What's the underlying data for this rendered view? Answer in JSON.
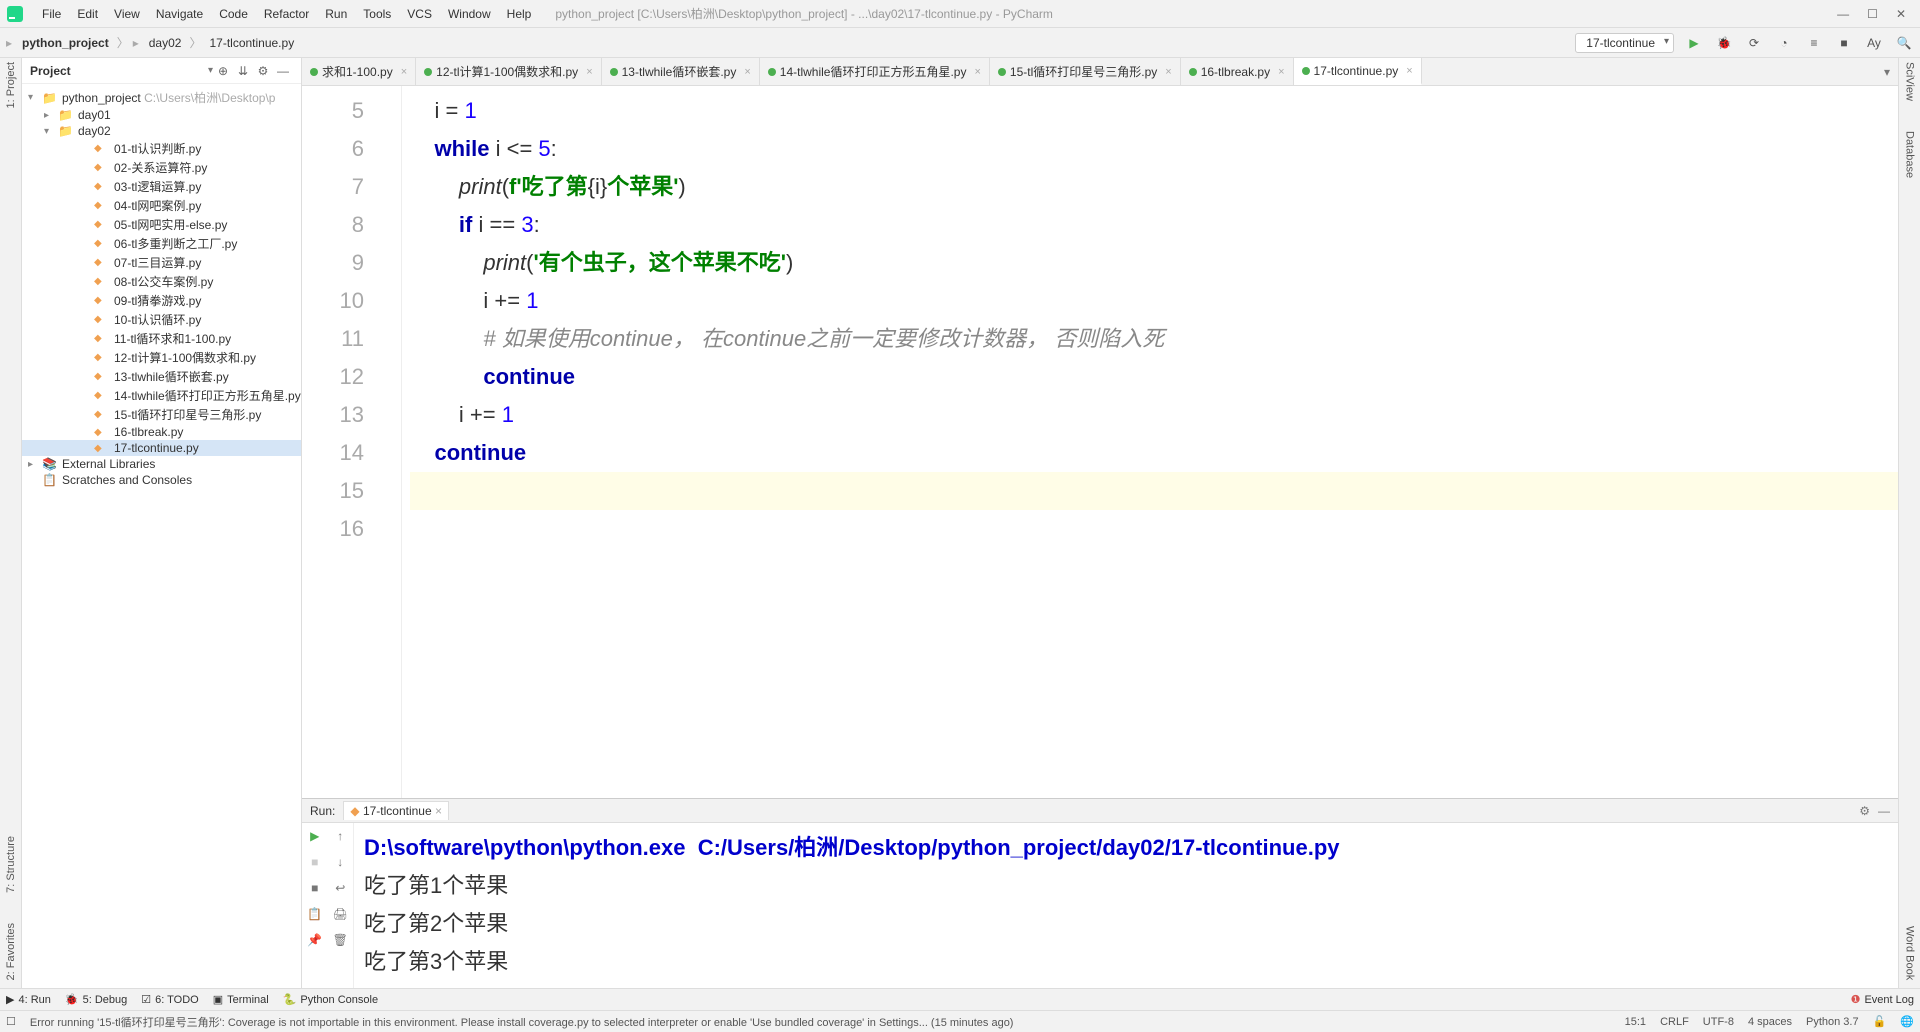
{
  "menubar": {
    "items": [
      "File",
      "Edit",
      "View",
      "Navigate",
      "Code",
      "Refactor",
      "Run",
      "Tools",
      "VCS",
      "Window",
      "Help"
    ],
    "window_title": "python_project [C:\\Users\\柏洲\\Desktop\\python_project] - ...\\day02\\17-tlcontinue.py - PyCharm"
  },
  "breadcrumb": {
    "crumbs": [
      "python_project",
      "day02",
      "17-tlcontinue.py"
    ]
  },
  "run_config": {
    "selected": "17-tlcontinue"
  },
  "project_panel": {
    "title": "Project",
    "root": {
      "name": "python_project",
      "path": "C:\\Users\\柏洲\\Desktop\\p"
    },
    "day01": "day01",
    "day02": "day02",
    "files": [
      "01-tl认识判断.py",
      "02-关系运算符.py",
      "03-tl逻辑运算.py",
      "04-tl网吧案例.py",
      "05-tl网吧实用-else.py",
      "06-tl多重判断之工厂.py",
      "07-tl三目运算.py",
      "08-tl公交车案例.py",
      "09-tl猜拳游戏.py",
      "10-tl认识循环.py",
      "11-tl循环求和1-100.py",
      "12-tl计算1-100偶数求和.py",
      "13-tlwhile循环嵌套.py",
      "14-tlwhile循环打印正方形五角星.py",
      "15-tl循环打印星号三角形.py",
      "16-tlbreak.py",
      "17-tlcontinue.py"
    ],
    "external": "External Libraries",
    "scratches": "Scratches and Consoles",
    "selected_file": "17-tlcontinue.py"
  },
  "tabs": [
    {
      "label": "求和1-100.py",
      "partial": true
    },
    {
      "label": "12-tl计算1-100偶数求和.py"
    },
    {
      "label": "13-tlwhile循环嵌套.py"
    },
    {
      "label": "14-tlwhile循环打印正方形五角星.py"
    },
    {
      "label": "15-tl循环打印星号三角形.py"
    },
    {
      "label": "16-tlbreak.py"
    },
    {
      "label": "17-tlcontinue.py",
      "active": true
    }
  ],
  "editor": {
    "line_numbers": [
      5,
      6,
      7,
      8,
      9,
      10,
      11,
      12,
      13,
      14,
      15,
      16
    ],
    "current_line": 15,
    "lines": {
      "l5": {
        "indent": 1,
        "tokens": [
          {
            "t": "i ",
            "c": ""
          },
          {
            "t": "= ",
            "c": ""
          },
          {
            "t": "1",
            "c": "num"
          }
        ]
      },
      "l6": {
        "indent": 1,
        "pre": "while ",
        "var": "i ",
        "op": "<= ",
        "num": "5",
        "colon": ":"
      },
      "l7": {
        "indent": 2,
        "fn": "print",
        "open": "(",
        "fpre": "f'",
        "str": "吃了第",
        "brace_open": "{",
        "var": "i",
        "brace_close": "}",
        "str2": "个苹果",
        "fend": "'",
        "close": ")"
      },
      "l8": {
        "indent": 2,
        "kw": "if ",
        "var": "i ",
        "op": "== ",
        "num": "3",
        "colon": ":"
      },
      "l9": {
        "indent": 3,
        "fn": "print",
        "open": "(",
        "str": "'有个虫子，这个苹果不吃'",
        "close": ")"
      },
      "l10": {
        "indent": 3,
        "var": "i ",
        "op": "+= ",
        "num": "1"
      },
      "l11": {
        "indent": 3,
        "comment": "# 如果使用continue， 在continue之前一定要修改计数器， 否则陷入死"
      },
      "l12": {
        "indent": 3,
        "kw": "continue"
      },
      "l13": {
        "indent": 2,
        "var": "i ",
        "op": "+= ",
        "num": "1"
      },
      "l14": {
        "indent": 1,
        "kw": "continue"
      },
      "l15": {
        "indent": 0,
        "blank": true
      },
      "l16": {
        "indent": 0,
        "blank": true
      }
    }
  },
  "run_tool": {
    "title": "Run:",
    "tab": "17-tlcontinue",
    "output": {
      "path": "D:\\software\\python\\python.exe  C:/Users/柏洲/Desktop/python_project/day02/17-tlcontinue.py",
      "lines": [
        "吃了第1个苹果",
        "吃了第2个苹果",
        "吃了第3个苹果"
      ]
    }
  },
  "bottom_tabs": {
    "run": "4: Run",
    "debug": "5: Debug",
    "todo": "6: TODO",
    "terminal": "Terminal",
    "python_console": "Python Console",
    "event_log": "Event Log"
  },
  "statusbar": {
    "msg": "Error running '15-tl循环打印星号三角形': Coverage is not importable in this environment. Please install coverage.py to selected interpreter or enable 'Use bundled coverage' in Settings... (15 minutes ago)",
    "pos": "15:1",
    "eol": "CRLF",
    "enc": "UTF-8",
    "indent": "4 spaces",
    "interp": "Python 3.7"
  },
  "side_tools": {
    "left_top": "1: Project",
    "left_mid": "7: Structure",
    "left_bot": "2: Favorites",
    "right_top": "SciView",
    "right_mid": "Database",
    "right_bot": "Word Book"
  }
}
